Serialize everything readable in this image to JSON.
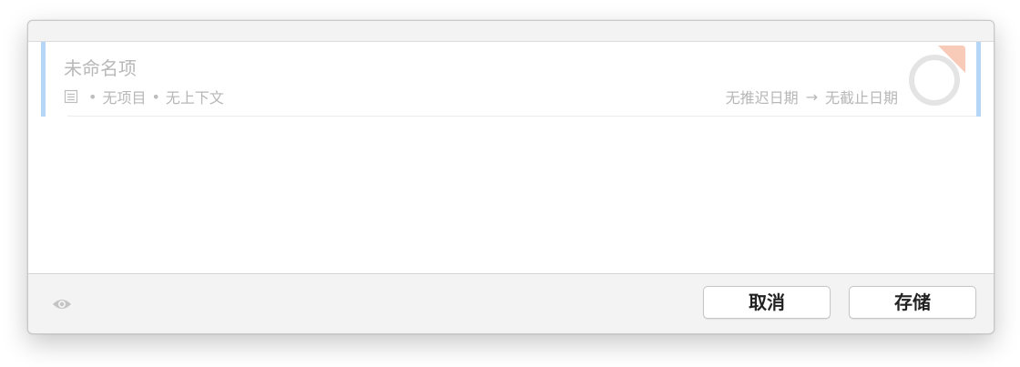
{
  "item": {
    "title_placeholder": "未命名项",
    "project": "无项目",
    "context": "无上下文",
    "bullet": "•",
    "defer_date": "无推迟日期",
    "arrow": "→",
    "due_date": "无截止日期"
  },
  "footer": {
    "cancel_label": "取消",
    "save_label": "存储"
  },
  "icons": {
    "note": "note-icon",
    "status": "status-circle-icon",
    "eye": "eye-icon"
  },
  "colors": {
    "selection_bar": "#b5d6f7",
    "flag_accent": "#f6b9a0",
    "placeholder_text": "#b9b9b9"
  }
}
